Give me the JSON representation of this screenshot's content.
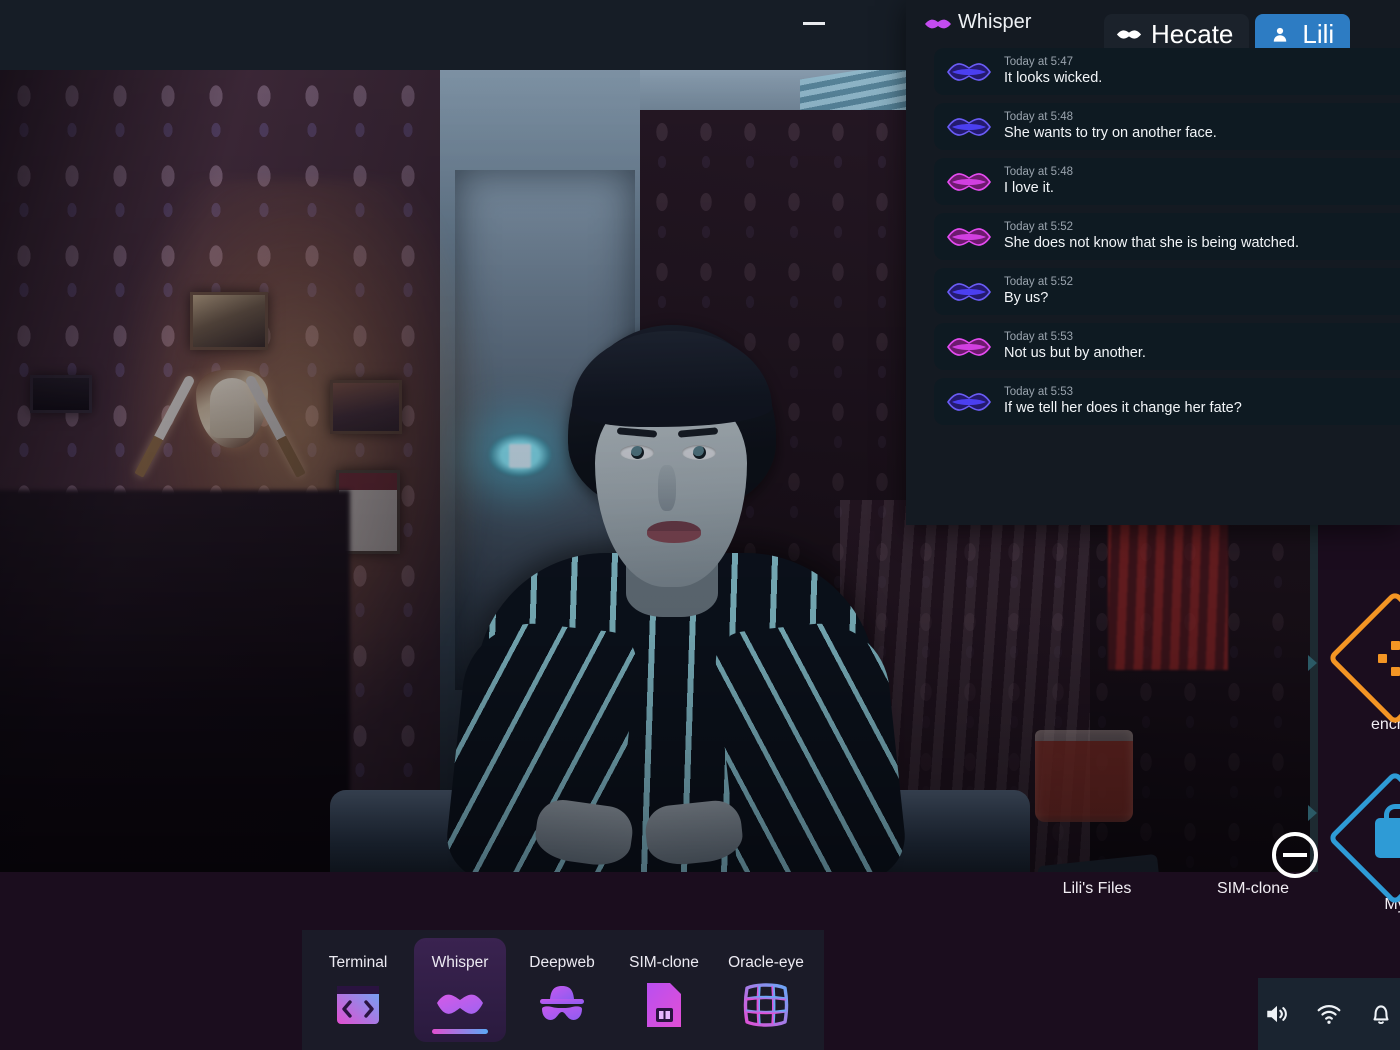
{
  "desktop": {
    "icons": [
      {
        "label": "Lili's Files",
        "icon": "folder-diamond-icon",
        "color": "#2e9bd6"
      },
      {
        "label": "SIM-clone",
        "icon": "sim-diamond-icon",
        "color": "#2e9bd6"
      },
      {
        "label": "My",
        "icon": "lock-diamond-icon",
        "color": "#2e9bd6"
      },
      {
        "label": "encryp",
        "icon": "encrypt-diamond-icon",
        "color": "#f39524"
      }
    ]
  },
  "video_window": {
    "minimize_label": "—",
    "minimize_icon": "minimize-icon",
    "collapse_icon": "circle-minus-icon",
    "scene_description": "Webcam video of a woman with short dark hair in a black-and-white vertically striped shirt, seated at a table in a dim room with damask wallpaper, framed portraits, crossed daggers on the wall, a desk lamp, a calendar, a glowing cyan wall lamp, and a glass of red drink."
  },
  "whisper": {
    "title": "Whisper",
    "title_icon": "lips-icon",
    "tabs": [
      {
        "label": "Hecate",
        "icon": "lips-icon",
        "active": false
      },
      {
        "label": "Lili",
        "icon": "person-icon",
        "active": true
      }
    ],
    "messages": [
      {
        "timestamp": "Today at 5:47",
        "text": "It looks wicked.",
        "avatar": "lips-blue-icon"
      },
      {
        "timestamp": "Today at 5:48",
        "text": "She wants to try on another face.",
        "avatar": "lips-blue-icon"
      },
      {
        "timestamp": "Today at 5:48",
        "text": "I love it.",
        "avatar": "lips-magenta-icon"
      },
      {
        "timestamp": "Today at 5:52",
        "text": "She does not know that she is being watched.",
        "avatar": "lips-magenta-icon"
      },
      {
        "timestamp": "Today at 5:52",
        "text": "By us?",
        "avatar": "lips-blue-icon"
      },
      {
        "timestamp": "Today at 5:53",
        "text": "Not us but by another.",
        "avatar": "lips-magenta-icon"
      },
      {
        "timestamp": "Today at 5:53",
        "text": "If we tell her does it change her fate?",
        "avatar": "lips-blue-icon"
      }
    ]
  },
  "dock": {
    "items": [
      {
        "label": "Terminal",
        "icon": "terminal-icon",
        "active": false
      },
      {
        "label": "Whisper",
        "icon": "lips-icon",
        "active": true
      },
      {
        "label": "Deepweb",
        "icon": "incognito-icon",
        "active": false
      },
      {
        "label": "SIM-clone",
        "icon": "sim-card-icon",
        "active": false
      },
      {
        "label": "Oracle-eye",
        "icon": "grid-icon",
        "active": false
      }
    ]
  },
  "tray": {
    "items": [
      {
        "icon": "volume-icon"
      },
      {
        "icon": "wifi-icon"
      },
      {
        "icon": "bell-icon"
      }
    ]
  },
  "colors": {
    "accent_blue": "#2d7cc3",
    "accent_magenta": "#e24fd0",
    "accent_orange": "#f39524",
    "window_bg": "#141a22",
    "desktop_bg": "#1b0d1e"
  }
}
